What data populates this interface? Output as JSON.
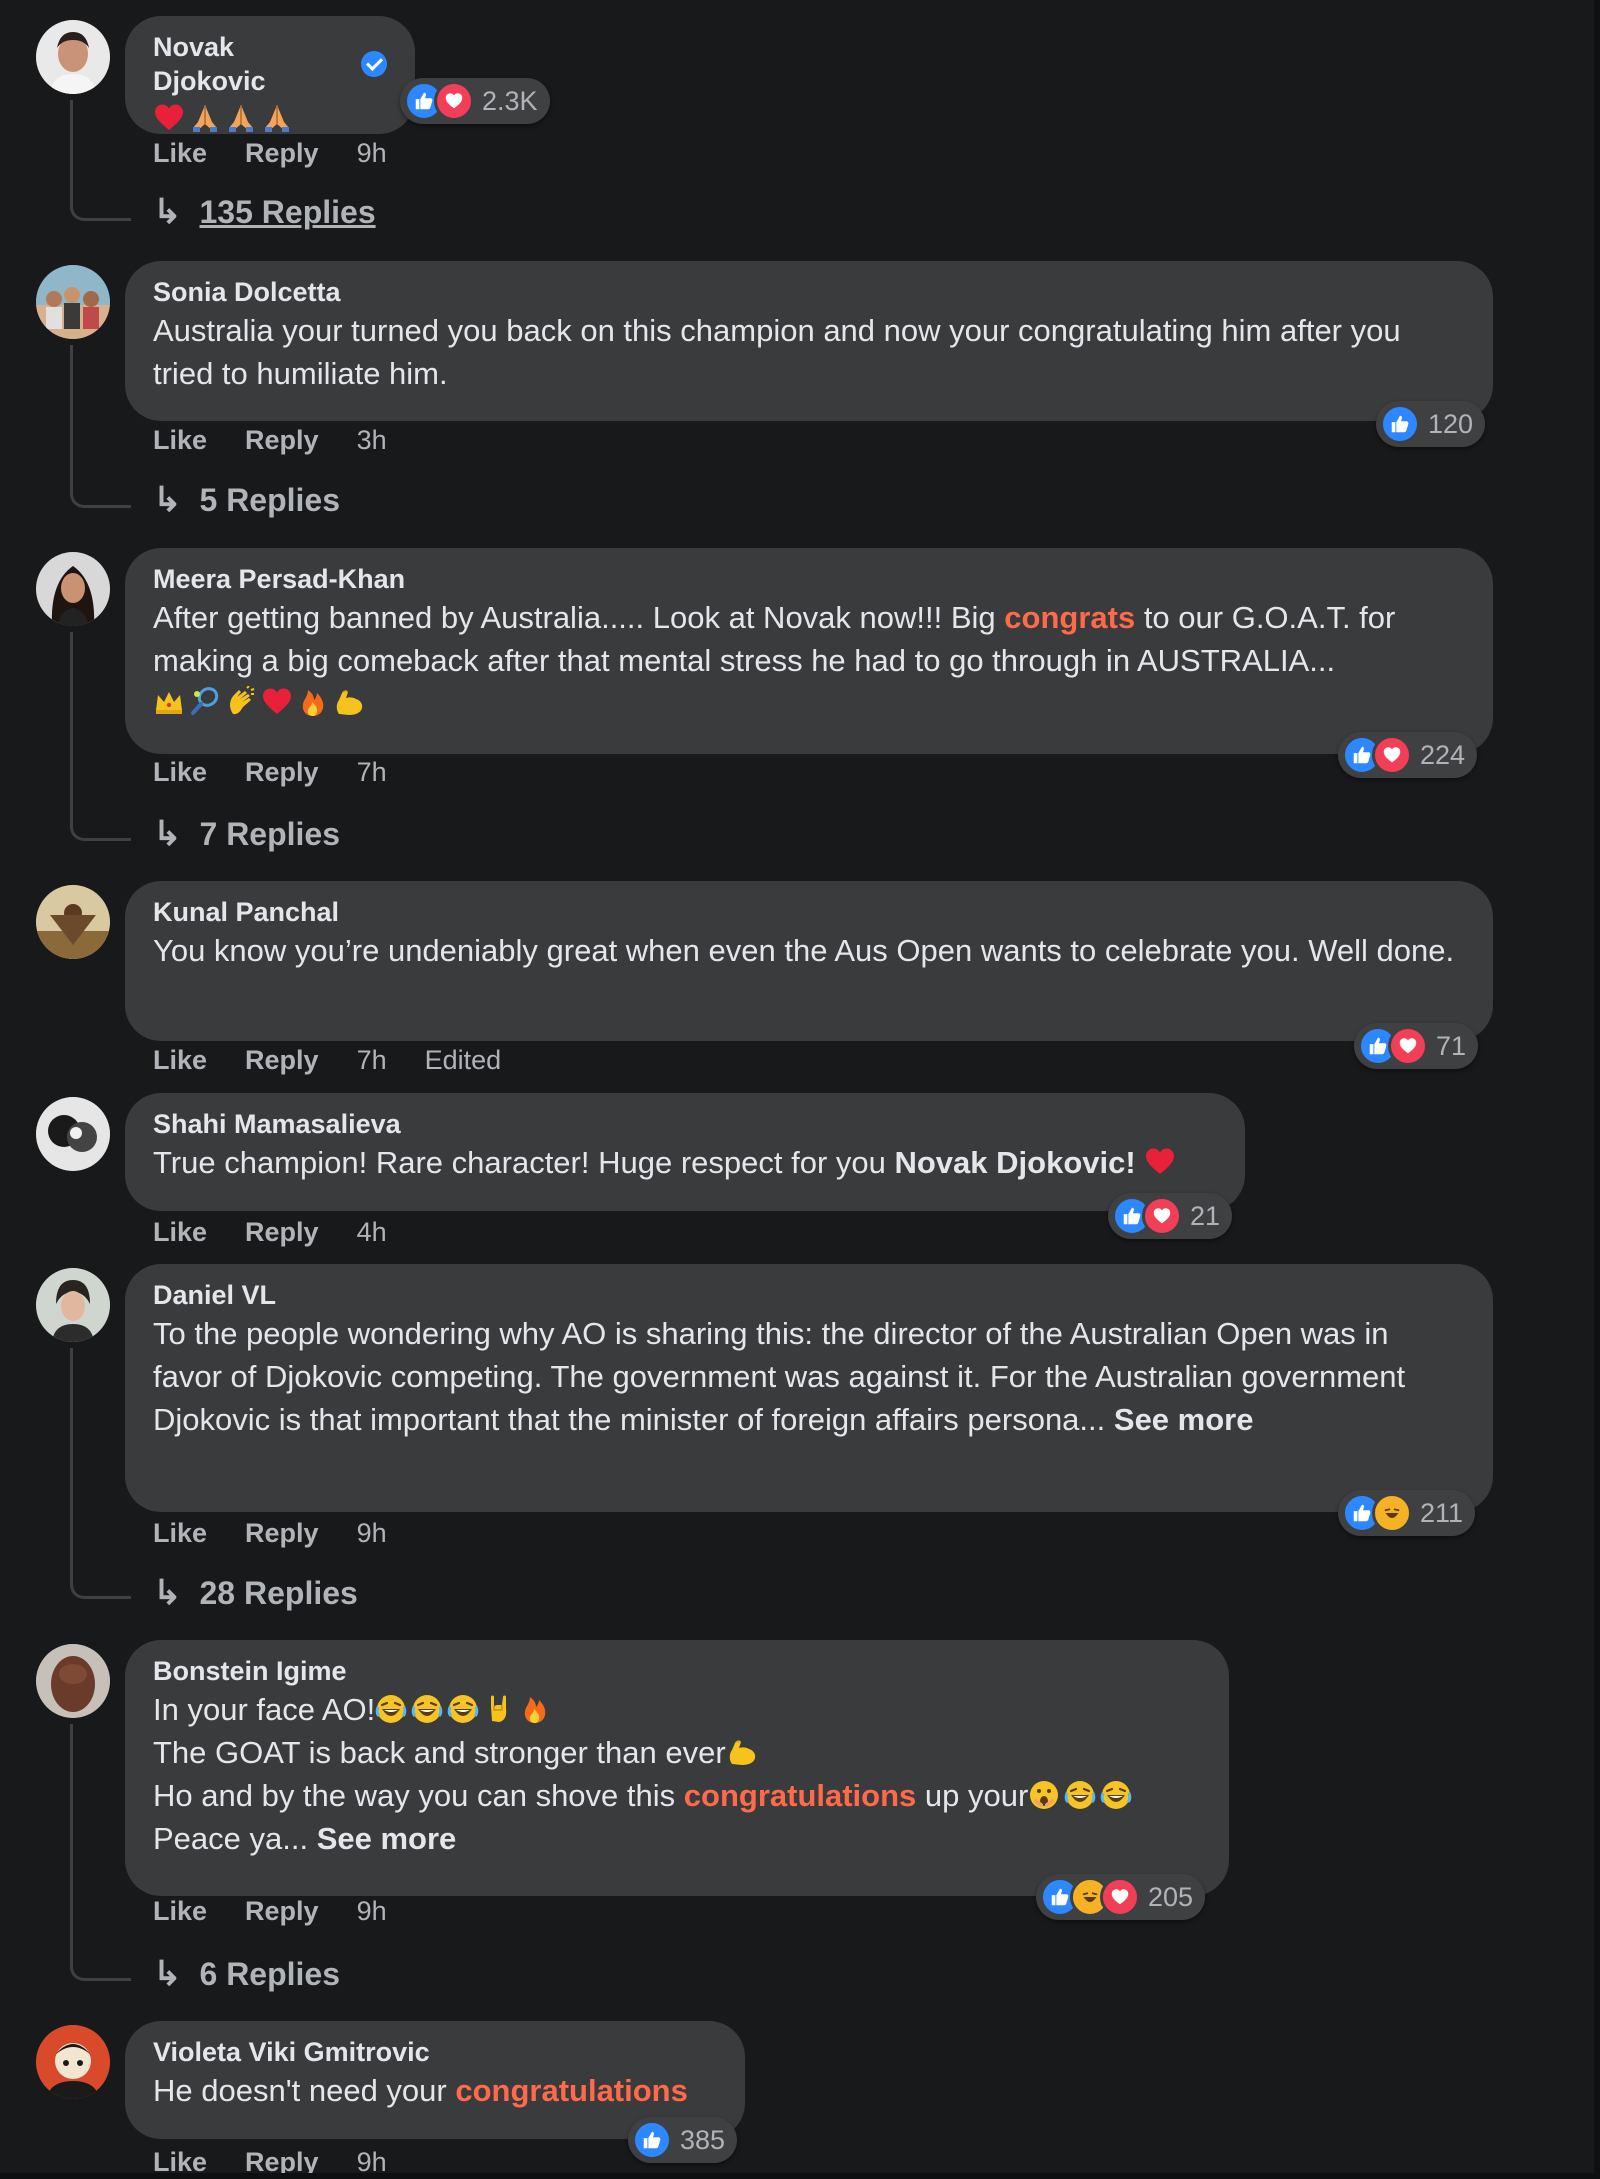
{
  "colors": {
    "background": "#18191a",
    "bubble": "#3a3b3c",
    "text": "#e4e6eb",
    "muted": "#b0b3b8",
    "highlight": "#ff6a4a",
    "like": "#2d88ff",
    "love": "#f33e58",
    "haha": "#f7b125"
  },
  "labels": {
    "like": "Like",
    "reply": "Reply",
    "see_more": "See more"
  },
  "comments": [
    {
      "author": "Novak Djokovic",
      "verified": true,
      "emojis": [
        "heart",
        "pray",
        "pray",
        "pray"
      ],
      "reactions": {
        "icons": [
          "like",
          "love"
        ],
        "count": "2.3K"
      },
      "time": "9h",
      "replies": "135 Replies"
    },
    {
      "author": "Sonia Dolcetta",
      "text": "Australia your turned you back on this champion and now your congratulating him after you tried to humiliate him.",
      "reactions": {
        "icons": [
          "like"
        ],
        "count": "120"
      },
      "time": "3h",
      "replies": "5 Replies"
    },
    {
      "author": "Meera Persad-Khan",
      "text_before": "After getting banned by Australia..... Look at Novak now!!! Big ",
      "text_highlight": "congrats",
      "text_after": " to our G.O.A.T. for making a big comeback after that mental stress he had to go through in AUSTRALIA...",
      "emojis": [
        "crown",
        "racket",
        "clap",
        "heart",
        "fire",
        "muscle"
      ],
      "reactions": {
        "icons": [
          "like",
          "love"
        ],
        "count": "224"
      },
      "time": "7h",
      "replies": "7 Replies"
    },
    {
      "author": "Kunal Panchal",
      "text": "You know you’re undeniably great when even the Aus Open wants to celebrate you. Well done.",
      "reactions": {
        "icons": [
          "like",
          "love"
        ],
        "count": "71"
      },
      "time": "7h",
      "edited": "Edited"
    },
    {
      "author": "Shahi Mamasalieva",
      "text_before": "True champion! Rare character! Huge respect for you ",
      "text_bold": "Novak Djokovic!",
      "emojis": [
        "heart"
      ],
      "reactions": {
        "icons": [
          "like",
          "love"
        ],
        "count": "21"
      },
      "time": "4h"
    },
    {
      "author": "Daniel VL",
      "text": "To the people wondering why AO is sharing this: the director of the Australian Open was in favor of Djokovic competing. The government was against it. For the Australian government Djokovic is that important that the minister of foreign affairs persona... ",
      "reactions": {
        "icons": [
          "like",
          "haha"
        ],
        "count": "211"
      },
      "time": "9h",
      "replies": "28 Replies"
    },
    {
      "author": "Bonstein Igime",
      "line1": "In your face AO!",
      "line1_emojis": [
        "laugh",
        "laugh",
        "laugh",
        "rock",
        "fire"
      ],
      "line2": "The GOAT is back and stronger than ever",
      "line2_emojis": [
        "muscle"
      ],
      "line3_before": "Ho and by the way you can shove this ",
      "line3_highlight": "congratulations",
      "line3_after": " up your",
      "line3_emojis": [
        "shush",
        "laugh",
        "laugh"
      ],
      "line4": "Peace ya... ",
      "reactions": {
        "icons": [
          "like",
          "haha",
          "love"
        ],
        "count": "205"
      },
      "time": "9h",
      "replies": "6 Replies"
    },
    {
      "author": "Violeta Viki Gmitrovic",
      "text_before": "He doesn't need your ",
      "text_highlight": "congratulations",
      "reactions": {
        "icons": [
          "like"
        ],
        "count": "385"
      },
      "time": "9h"
    }
  ]
}
